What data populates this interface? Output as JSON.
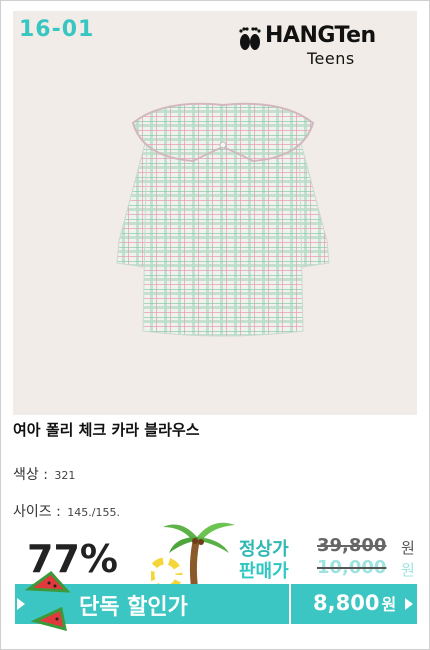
{
  "item_code": "16-01",
  "brand": {
    "name": "HANGTen",
    "sub": "Teens"
  },
  "product": {
    "name": "여아 폴리 체크 카라 블라우스",
    "color_label": "색상 :",
    "color_value": "321",
    "size_label": "사이즈 :",
    "size_value": "145./155."
  },
  "discount_rate": "77%",
  "pricing": {
    "regular_label": "정상가",
    "regular_price": "39,800",
    "sale_label": "판매가",
    "sale_price": "10,000",
    "won": "원"
  },
  "promo": {
    "label": "단독 할인가",
    "price": "8,800",
    "won": "원"
  },
  "colors": {
    "accent": "#3cc6c3",
    "background": "#f1ece7"
  },
  "icons": [
    "hang-ten-feet-icon",
    "palm-tree-icon",
    "swim-ring-icon",
    "watermelon-icon",
    "arrow-icon"
  ]
}
